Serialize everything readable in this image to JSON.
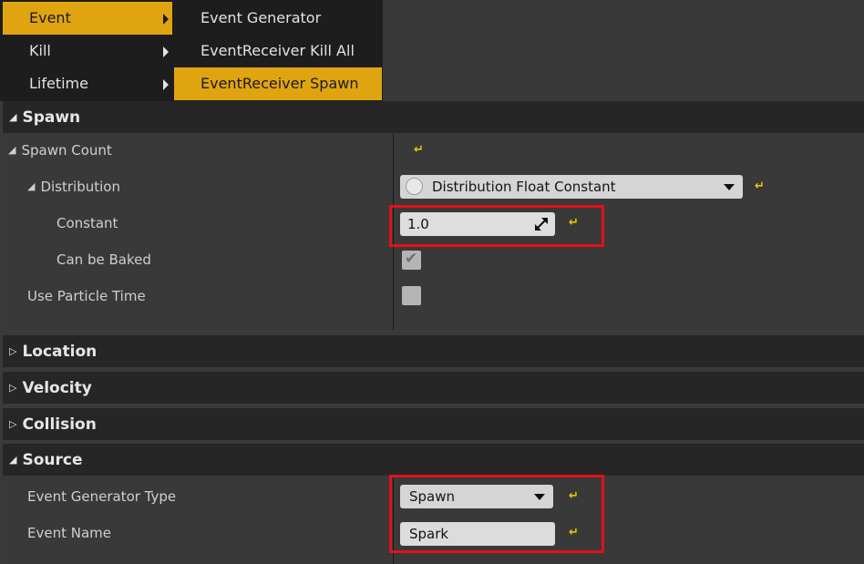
{
  "menu": {
    "main_items": [
      {
        "label": "Event",
        "highlighted": true
      },
      {
        "label": "Kill",
        "highlighted": false
      },
      {
        "label": "Lifetime",
        "highlighted": false
      }
    ],
    "sub_items": [
      {
        "label": "Event Generator",
        "highlighted": false
      },
      {
        "label": "EventReceiver Kill All",
        "highlighted": false
      },
      {
        "label": "EventReceiver Spawn",
        "highlighted": true
      }
    ]
  },
  "spawn_section": {
    "title": "Spawn",
    "spawn_count_label": "Spawn Count",
    "distribution_label": "Distribution",
    "distribution_value": "Distribution Float Constant",
    "constant_label": "Constant",
    "constant_value": "1.0",
    "can_be_baked_label": "Can be Baked",
    "can_be_baked_checked": true,
    "use_particle_time_label": "Use Particle Time",
    "use_particle_time_checked": false
  },
  "collapsed_sections": [
    "Location",
    "Velocity",
    "Collision"
  ],
  "source_section": {
    "title": "Source",
    "event_generator_type_label": "Event Generator Type",
    "event_generator_type_value": "Spawn",
    "event_name_label": "Event Name",
    "event_name_value": "Spark"
  },
  "icons": {
    "reset": "reset-to-default-icon",
    "expanded": "triangle-down-icon",
    "collapsed": "triangle-right-icon"
  },
  "colors": {
    "menu_highlight": "#e1a411",
    "reset_icon": "#f2c100",
    "annotation_box": "#e4101c"
  }
}
